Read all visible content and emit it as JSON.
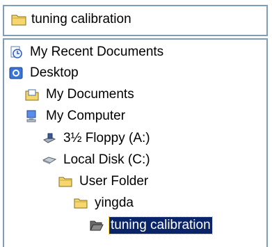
{
  "combo": {
    "selected": "tuning calibration",
    "icon": "folder-icon"
  },
  "tree": {
    "items": [
      {
        "label": "My Recent Documents",
        "icon": "recent-documents-icon"
      },
      {
        "label": "Desktop",
        "icon": "desktop-icon"
      },
      {
        "label": "My Documents",
        "icon": "my-documents-icon"
      },
      {
        "label": "My Computer",
        "icon": "my-computer-icon"
      },
      {
        "label": "3½ Floppy (A:)",
        "icon": "floppy-drive-icon"
      },
      {
        "label": "Local Disk (C:)",
        "icon": "hard-disk-icon"
      },
      {
        "label": "User Folder",
        "icon": "folder-icon"
      },
      {
        "label": "yingda",
        "icon": "folder-icon"
      },
      {
        "label": "tuning calibration",
        "icon": "open-folder-icon",
        "selected": true
      }
    ]
  },
  "colors": {
    "border": "#7f9db9",
    "selection": "#0a246a",
    "folder": "#f5d76e"
  }
}
